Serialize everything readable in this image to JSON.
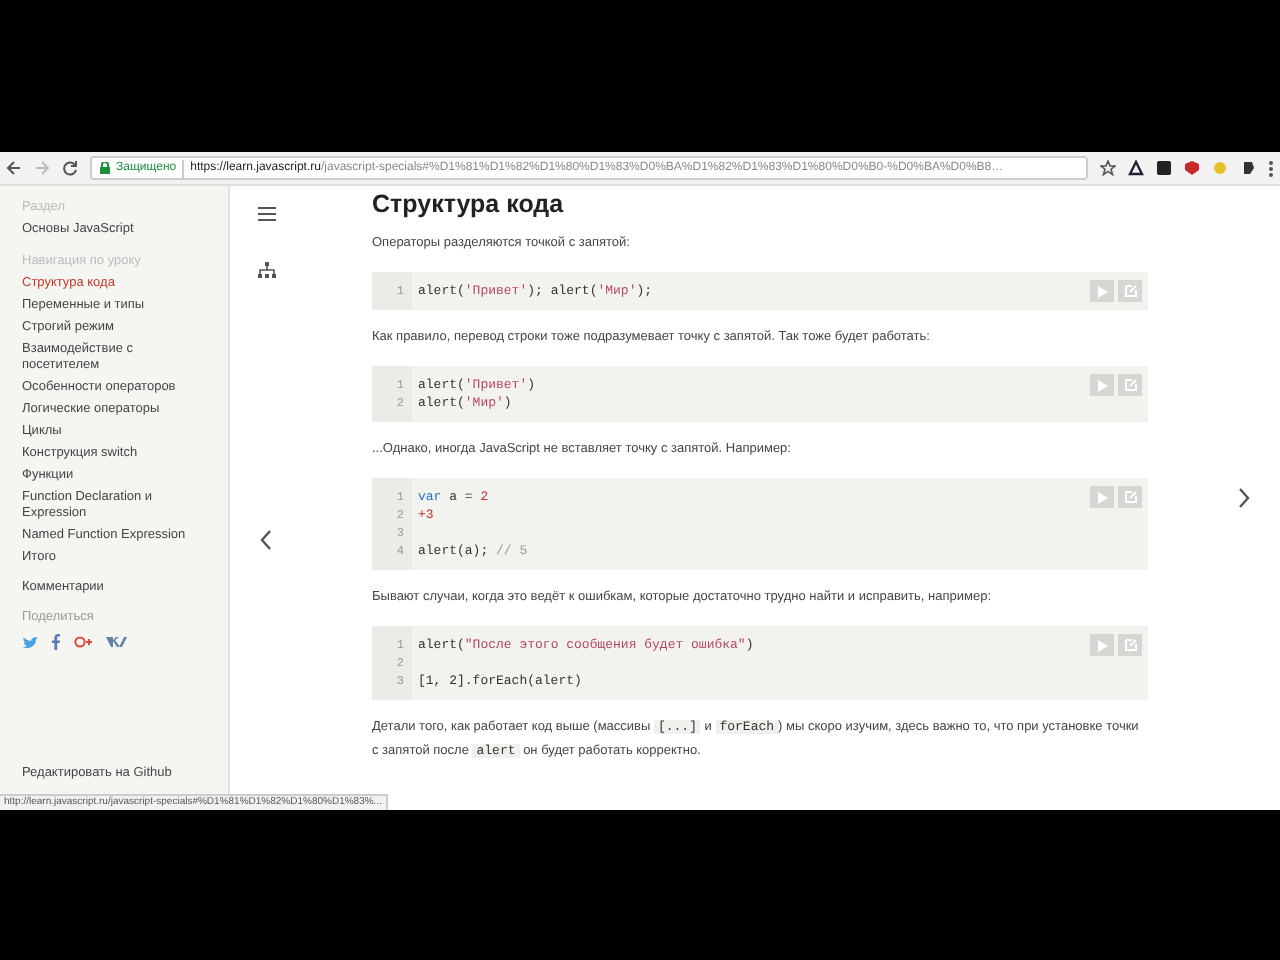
{
  "browser": {
    "security_label": "Защищено",
    "url_host": "https://learn.javascript.ru",
    "url_path": "/javascript-specials#%D1%81%D1%82%D1%80%D1%83%D0%BA%D1%82%D1%83%D1%80%D0%B0-%D0%BA%D0%B8…"
  },
  "sidebar": {
    "sections_heading": "Раздел",
    "section_link": "Основы JavaScript",
    "nav_heading": "Навигация по уроку",
    "items": [
      {
        "label": "Структура кода",
        "selected": true
      },
      {
        "label": "Переменные и типы",
        "selected": false
      },
      {
        "label": "Строгий режим",
        "selected": false
      },
      {
        "label": "Взаимодействие с посетителем",
        "selected": false
      },
      {
        "label": "Особенности операторов",
        "selected": false
      },
      {
        "label": "Логические операторы",
        "selected": false
      },
      {
        "label": "Циклы",
        "selected": false
      },
      {
        "label": "Конструкция switch",
        "selected": false
      },
      {
        "label": "Функции",
        "selected": false
      },
      {
        "label": "Function Declaration и Expression",
        "selected": false
      },
      {
        "label": "Named Function Expression",
        "selected": false
      },
      {
        "label": "Итого",
        "selected": false
      }
    ],
    "comments_link": "Комментарии",
    "share_heading": "Поделиться",
    "edit_link": "Редактировать на Github"
  },
  "article": {
    "title": "Структура кода",
    "blocks": [
      {
        "kind": "text",
        "parts": [
          {
            "text": "Операторы разделяются точкой с запятой:",
            "code": false
          }
        ]
      },
      {
        "kind": "code",
        "lines": [
          {
            "number": "1",
            "tokens": [
              {
                "text": "alert(",
                "kind": "plain"
              },
              {
                "text": "'Привет'",
                "kind": "string"
              },
              {
                "text": "); alert(",
                "kind": "plain"
              },
              {
                "text": "'Мир'",
                "kind": "string"
              },
              {
                "text": ");",
                "kind": "plain"
              }
            ]
          }
        ]
      },
      {
        "kind": "text",
        "parts": [
          {
            "text": "Как правило, перевод строки тоже подразумевает точку с запятой. Так тоже будет работать:",
            "code": false
          }
        ]
      },
      {
        "kind": "code",
        "lines": [
          {
            "number": "1",
            "tokens": [
              {
                "text": "alert(",
                "kind": "plain"
              },
              {
                "text": "'Привет'",
                "kind": "string"
              },
              {
                "text": ")",
                "kind": "plain"
              }
            ]
          },
          {
            "number": "2",
            "tokens": [
              {
                "text": "alert(",
                "kind": "plain"
              },
              {
                "text": "'Мир'",
                "kind": "string"
              },
              {
                "text": ")",
                "kind": "plain"
              }
            ]
          }
        ]
      },
      {
        "kind": "text",
        "parts": [
          {
            "text": "...Однако, иногда JavaScript не вставляет точку с запятой. Например:",
            "code": false
          }
        ]
      },
      {
        "kind": "code",
        "lines": [
          {
            "number": "1",
            "tokens": [
              {
                "text": "var",
                "kind": "keyword"
              },
              {
                "text": " a = ",
                "kind": "plain"
              },
              {
                "text": "2",
                "kind": "number"
              }
            ]
          },
          {
            "number": "2",
            "tokens": [
              {
                "text": "+3",
                "kind": "number"
              }
            ]
          },
          {
            "number": "3"
          },
          {
            "number": "4",
            "tokens": [
              {
                "text": "alert(a); ",
                "kind": "plain"
              },
              {
                "text": "// 5",
                "kind": "comment"
              }
            ]
          }
        ]
      },
      {
        "kind": "text",
        "parts": [
          {
            "text": "Бывают случаи, когда это ведёт к ошибкам, которые достаточно трудно найти и исправить, например:",
            "code": false
          }
        ]
      },
      {
        "kind": "code",
        "lines": [
          {
            "number": "1",
            "tokens": [
              {
                "text": "alert(",
                "kind": "plain"
              },
              {
                "text": "\"После этого сообщения будет ошибка\"",
                "kind": "string"
              },
              {
                "text": ")",
                "kind": "plain"
              }
            ]
          },
          {
            "number": "2"
          },
          {
            "number": "3",
            "tokens": [
              {
                "text": "[1, 2].forEach(alert)",
                "kind": "plain"
              }
            ]
          }
        ]
      },
      {
        "kind": "text",
        "parts": [
          {
            "text": "Детали того, как работает код выше (массивы ",
            "code": false
          },
          {
            "text": "[...]",
            "code": true
          },
          {
            "text": " и ",
            "code": false
          },
          {
            "text": "forEach",
            "code": true
          },
          {
            "text": ") мы скоро изучим, здесь важно то, что при установке точки с запятой после ",
            "code": false
          },
          {
            "text": "alert",
            "code": true
          },
          {
            "text": " он будет работать корректно.",
            "code": false
          }
        ]
      }
    ]
  },
  "status_bar": {
    "url": "http://learn.javascript.ru/javascript-specials#%D1%81%D1%82%D1%80%D1%83%..."
  }
}
